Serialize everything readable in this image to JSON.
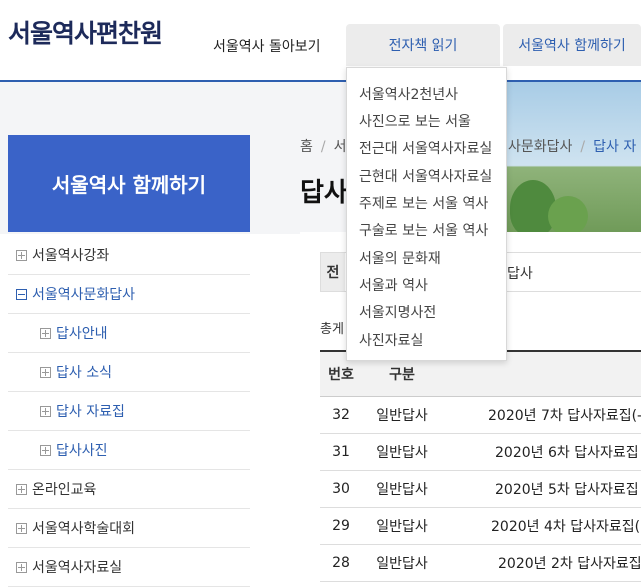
{
  "header": {
    "logo": "서울역사편찬원",
    "nav": [
      {
        "label": "서울역사 돌아보기"
      },
      {
        "label": "전자책 읽기"
      },
      {
        "label": "서울역사 함께하기"
      }
    ]
  },
  "dropdown": {
    "items": [
      "서울역사2천년사",
      "사진으로 보는 서울",
      "전근대 서울역사자료실",
      "근현대 서울역사자료실",
      "주제로 보는 서울 역사",
      "구술로 보는 서울 역사",
      "서울의 문화재",
      "서울과 역사",
      "서울지명사전",
      "사진자료실"
    ]
  },
  "sidebar": {
    "title": "서울역사 함께하기",
    "items": [
      {
        "label": "서울역사강좌"
      },
      {
        "label": "서울역사문화답사"
      },
      {
        "label": "답사안내"
      },
      {
        "label": "답사 소식"
      },
      {
        "label": "답사 자료집"
      },
      {
        "label": "답사사진"
      },
      {
        "label": "온라인교육"
      },
      {
        "label": "서울역사학술대회"
      },
      {
        "label": "서울역사자료실"
      }
    ]
  },
  "breadcrumb": {
    "home": "홈",
    "partial1": "서",
    "partial2": "사문화답사",
    "current": "답사 자"
  },
  "page": {
    "title": "답사",
    "tab_first": "전",
    "tab_other": "답사",
    "total": "총게"
  },
  "table": {
    "headers": {
      "num": "번호",
      "type": "구분",
      "title": ""
    },
    "rows": [
      {
        "num": "32",
        "type": "일반답사",
        "title": "2020년 7차 답사자료집(-"
      },
      {
        "num": "31",
        "type": "일반답사",
        "title": "2020년 6차 답사자료집"
      },
      {
        "num": "30",
        "type": "일반답사",
        "title": "2020년 5차 답사자료집"
      },
      {
        "num": "29",
        "type": "일반답사",
        "title": "2020년 4차 답사자료집("
      },
      {
        "num": "28",
        "type": "일반답사",
        "title": "2020년 2차 답사자료집"
      }
    ]
  },
  "colors": {
    "brand_blue": "#3a63c8",
    "link_blue": "#2e5fb0",
    "logo_navy": "#1d2a5a"
  }
}
